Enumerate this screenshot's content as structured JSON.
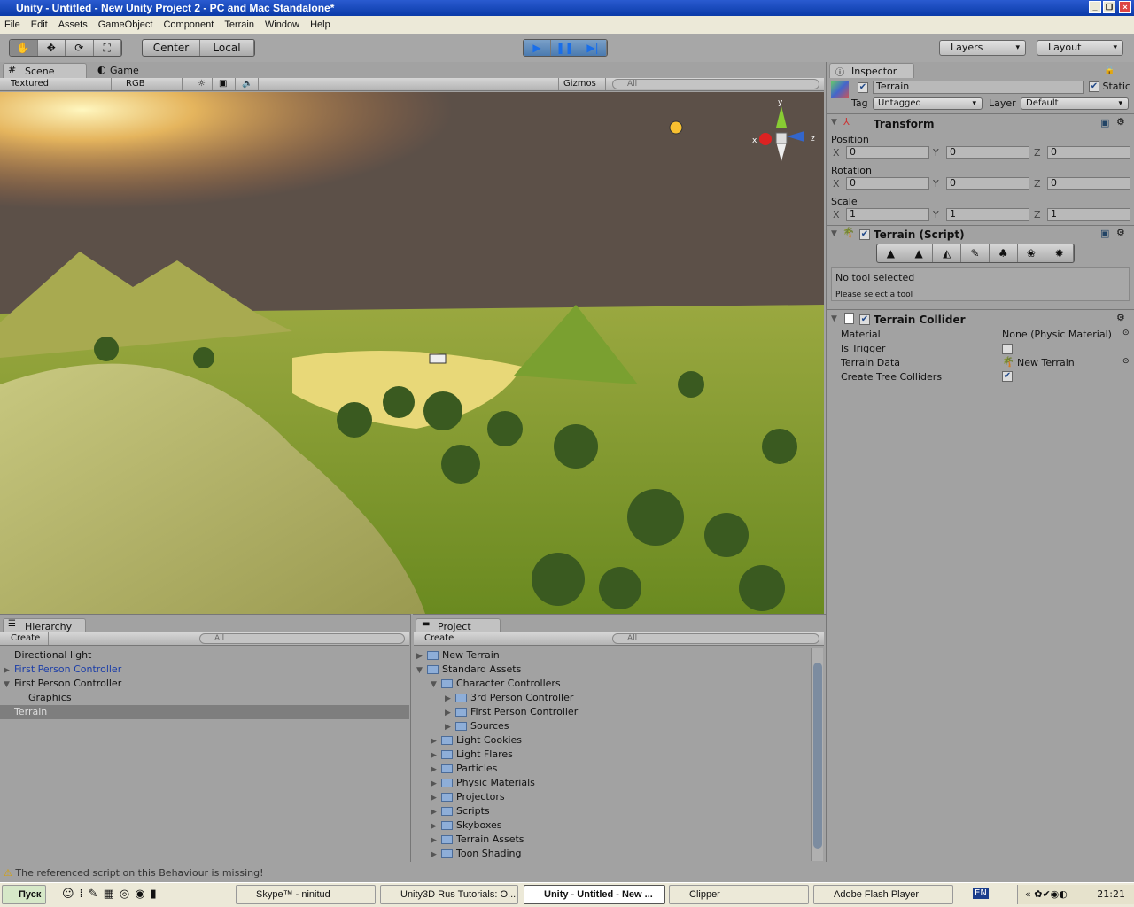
{
  "window": {
    "title": "Unity - Untitled - New Unity Project 2 - PC and Mac Standalone*"
  },
  "menu": [
    "File",
    "Edit",
    "Assets",
    "GameObject",
    "Component",
    "Terrain",
    "Window",
    "Help"
  ],
  "toolbar": {
    "pivot": "Center",
    "space": "Local",
    "layers": "Layers",
    "layout": "Layout"
  },
  "scene": {
    "tabs": [
      "Scene",
      "Game"
    ],
    "shading": "Textured",
    "render": "RGB",
    "gizmos": "Gizmos",
    "search": "All",
    "axes": [
      "y",
      "x",
      "z"
    ]
  },
  "inspector": {
    "tab": "Inspector",
    "name": "Terrain",
    "static": "Static",
    "tag_label": "Tag",
    "tag": "Untagged",
    "layer_label": "Layer",
    "layer": "Default",
    "transform": {
      "title": "Transform",
      "position": "Position",
      "rotation": "Rotation",
      "scale": "Scale",
      "axes": [
        "X",
        "Y",
        "Z"
      ],
      "pos": [
        "0",
        "0",
        "0"
      ],
      "rot": [
        "0",
        "0",
        "0"
      ],
      "scl": [
        "1",
        "1",
        "1"
      ]
    },
    "terrain_script": {
      "title": "Terrain (Script)",
      "msg": "No tool selected",
      "hint": "Please select a tool"
    },
    "collider": {
      "title": "Terrain Collider",
      "props": [
        {
          "label": "Material",
          "value": "None (Physic Material)"
        },
        {
          "label": "Is Trigger",
          "value": ""
        },
        {
          "label": "Terrain Data",
          "value": "New Terrain"
        },
        {
          "label": "Create Tree Colliders",
          "value": ""
        }
      ]
    }
  },
  "hierarchy": {
    "tab": "Hierarchy",
    "create": "Create",
    "search": "All",
    "items": [
      "Directional light",
      "First Person Controller",
      "First Person Controller",
      "Graphics",
      "Terrain"
    ]
  },
  "project": {
    "tab": "Project",
    "create": "Create",
    "search": "All",
    "items": [
      "New Terrain",
      "Standard Assets",
      "Character Controllers",
      "3rd Person Controller",
      "First Person Controller",
      "Sources",
      "Light Cookies",
      "Light Flares",
      "Particles",
      "Physic Materials",
      "Projectors",
      "Scripts",
      "Skyboxes",
      "Terrain Assets",
      "Toon Shading"
    ]
  },
  "status": "The referenced script on this Behaviour is missing!",
  "taskbar": {
    "start": "Пуск",
    "tasks": [
      "Skype™ - ninitud",
      "Unity3D Rus Tutorials: O...",
      "Unity - Untitled - New ...",
      "Clipper",
      "Adobe Flash Player"
    ],
    "lang": "EN",
    "clock": "21:21"
  }
}
